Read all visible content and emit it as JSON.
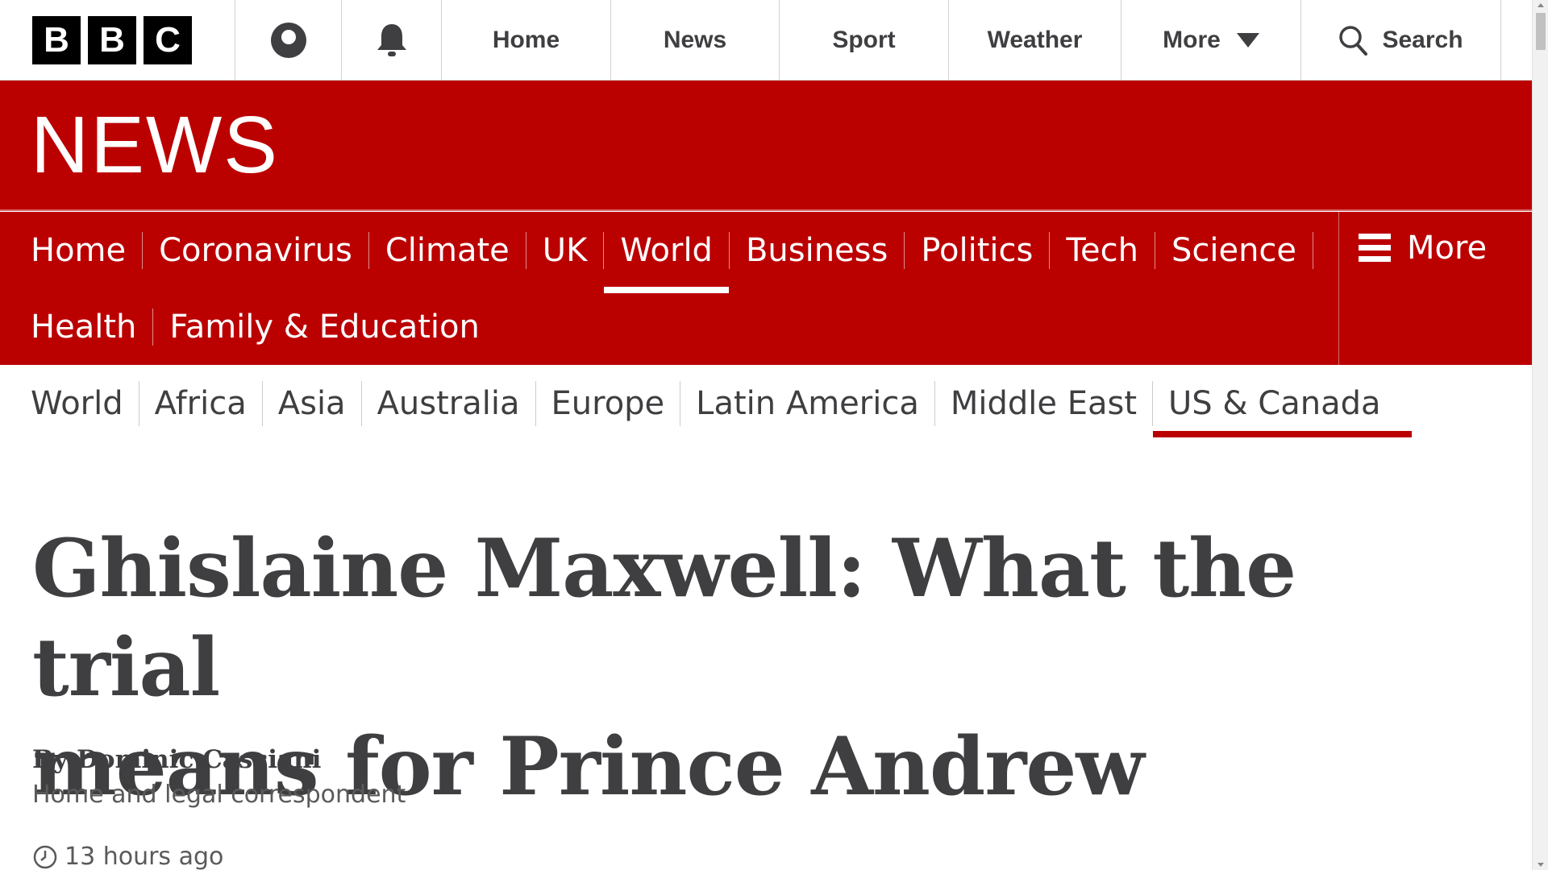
{
  "colors": {
    "brand_red": "#bb0000",
    "text": "#3f3f42",
    "white": "#ffffff"
  },
  "global_nav": {
    "logo_letters": [
      "B",
      "B",
      "C"
    ],
    "account_icon": "user-icon",
    "notifications_icon": "bell-icon",
    "items": [
      {
        "label": "Home"
      },
      {
        "label": "News"
      },
      {
        "label": "Sport"
      },
      {
        "label": "Weather"
      }
    ],
    "more_label": "More",
    "more_icon": "caret-down-icon",
    "search_label": "Search",
    "search_icon": "search-icon"
  },
  "news_banner": {
    "wordmark": "NEWS"
  },
  "section_nav": {
    "rows": [
      [
        {
          "label": "Home"
        },
        {
          "label": "Coronavirus"
        },
        {
          "label": "Climate"
        },
        {
          "label": "UK"
        },
        {
          "label": "World",
          "current": true
        },
        {
          "label": "Business"
        },
        {
          "label": "Politics"
        },
        {
          "label": "Tech"
        },
        {
          "label": "Science"
        }
      ],
      [
        {
          "label": "Health"
        },
        {
          "label": "Family & Education"
        }
      ]
    ],
    "more_label": "More",
    "more_icon": "menu-icon"
  },
  "sub_nav": {
    "items": [
      {
        "label": "World"
      },
      {
        "label": "Africa"
      },
      {
        "label": "Asia"
      },
      {
        "label": "Australia"
      },
      {
        "label": "Europe"
      },
      {
        "label": "Latin America"
      },
      {
        "label": "Middle East"
      },
      {
        "label": "US & Canada",
        "current": true
      }
    ]
  },
  "article": {
    "headline_line1": "Ghislaine Maxwell: What the trial",
    "headline_line2": "means for Prince Andrew",
    "byline": "By Dominic Casciani",
    "byline_role": "Home and legal correspondent",
    "timestamp": "13 hours ago",
    "timestamp_icon": "clock-icon"
  }
}
